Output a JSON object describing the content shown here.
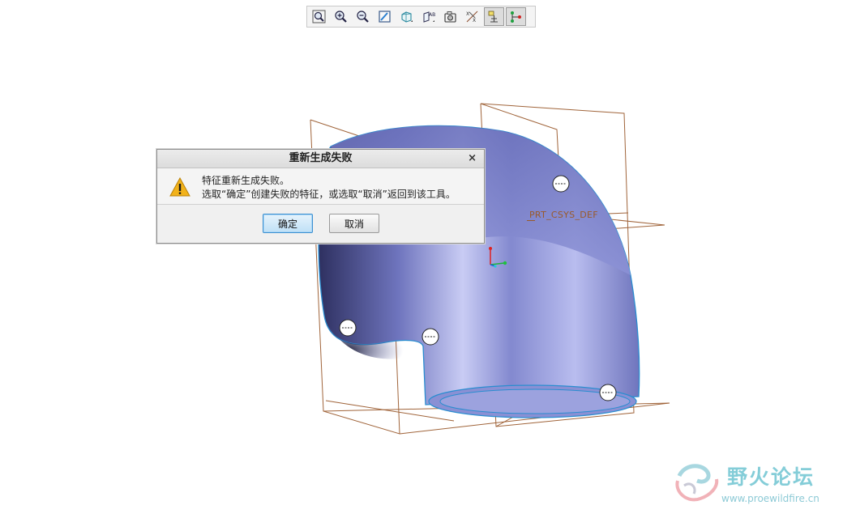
{
  "toolbar": {
    "buttons": [
      {
        "icon": "zoom-fit-icon"
      },
      {
        "icon": "zoom-in-icon"
      },
      {
        "icon": "zoom-out-icon"
      },
      {
        "icon": "repaint-icon"
      },
      {
        "icon": "display-style-icon"
      },
      {
        "icon": "saved-views-icon"
      },
      {
        "icon": "spin-center-icon"
      },
      {
        "icon": "datum-display-icon"
      },
      {
        "icon": "annotation-display-icon"
      },
      {
        "icon": "tree-display-icon"
      }
    ]
  },
  "viewport": {
    "datum_label": "PRT_CSYS_DEF",
    "model_color": "#7b82c6"
  },
  "dialog": {
    "title": "重新生成失败",
    "close": "×",
    "message_line1": "特征重新生成失败。",
    "message_line2": "选取“确定”创建失败的特征，或选取“取消”返回到该工具。",
    "ok_label": "确定",
    "cancel_label": "取消"
  },
  "watermark": {
    "name": "野火论坛",
    "url": "www.proewildfire.cn"
  }
}
